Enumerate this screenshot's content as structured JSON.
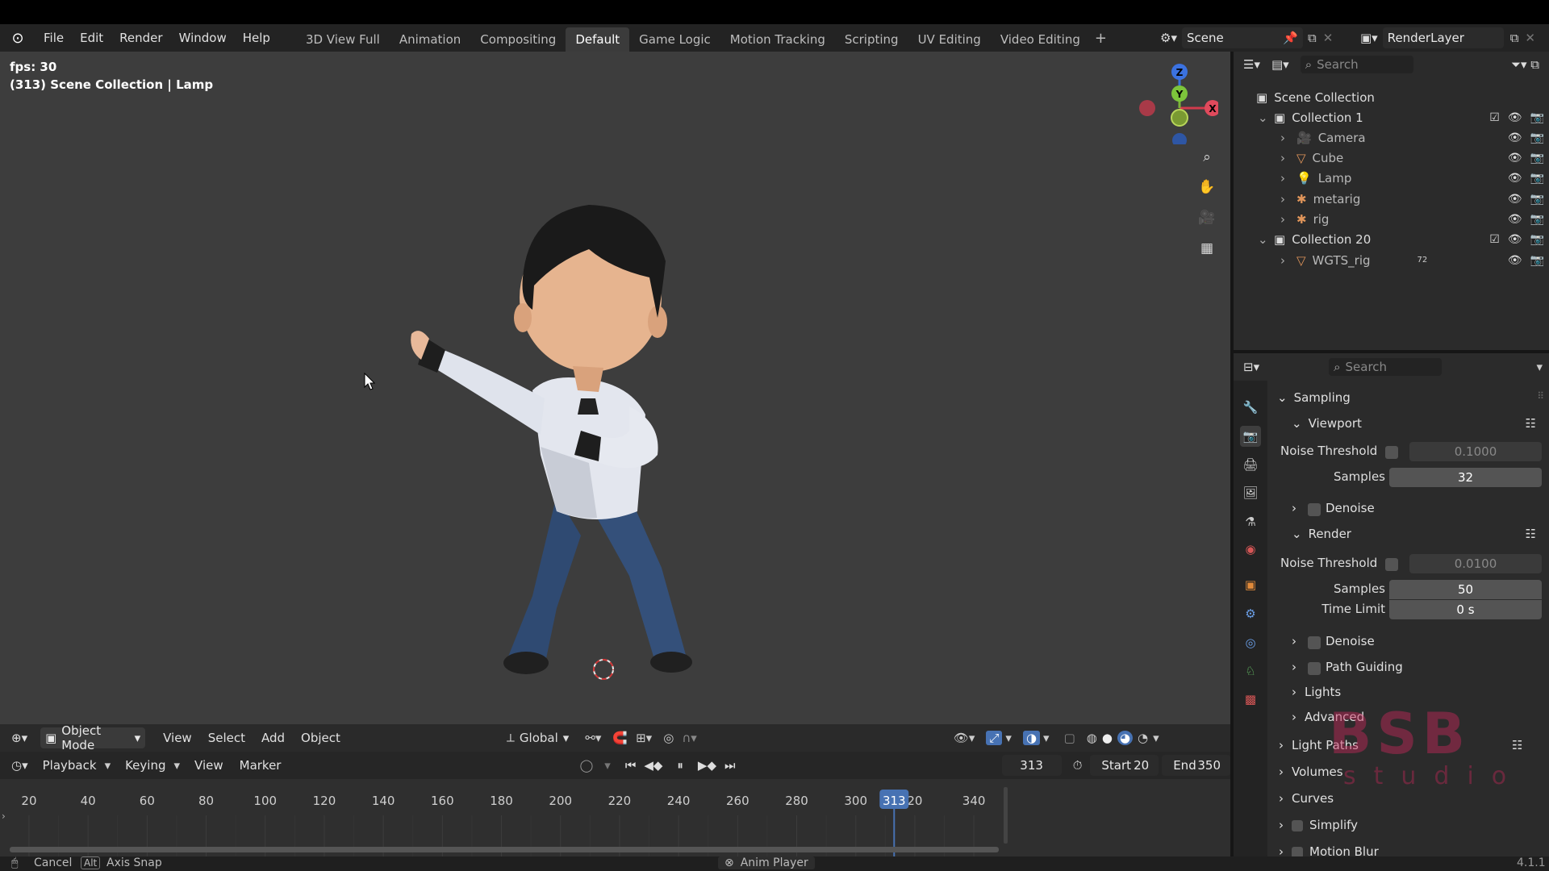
{
  "menu": [
    "File",
    "Edit",
    "Render",
    "Window",
    "Help"
  ],
  "workspaces": [
    "3D View Full",
    "Animation",
    "Compositing",
    "Default",
    "Game Logic",
    "Motion Tracking",
    "Scripting",
    "UV Editing",
    "Video Editing"
  ],
  "active_workspace": "Default",
  "scene_name": "Scene",
  "view_layer": "RenderLayer",
  "viewport": {
    "fps": "fps: 30",
    "context": "(313) Scene Collection | Lamp",
    "gizmo": {
      "z": "Z",
      "y": "Y",
      "x": "X"
    }
  },
  "viewport_header": {
    "mode": "Object Mode",
    "menus": [
      "View",
      "Select",
      "Add",
      "Object"
    ],
    "orientation": "Global"
  },
  "timeline": {
    "menus": [
      "Playback",
      "Keying",
      "View",
      "Marker"
    ],
    "current_frame": "313",
    "start_label": "Start",
    "start": "20",
    "end_label": "End",
    "end": "350",
    "ticks": [
      "20",
      "40",
      "60",
      "80",
      "100",
      "120",
      "140",
      "160",
      "180",
      "200",
      "220",
      "240",
      "260",
      "280",
      "300",
      "320",
      "340"
    ],
    "ticks_shown": [
      "20",
      "40",
      "60",
      "80",
      "100",
      "120",
      "140",
      "160",
      "180",
      "200",
      "220",
      "240",
      "260",
      "280",
      "300",
      "20",
      "340"
    ],
    "frame_min": 14,
    "frame_max": 355
  },
  "status": {
    "cancel": "Cancel",
    "alt": "Alt",
    "axis_snap": "Axis Snap",
    "anim_player": "Anim Player",
    "version": "4.1.1"
  },
  "outliner": {
    "search_placeholder": "Search",
    "root": "Scene Collection",
    "items": [
      {
        "label": "Collection 1",
        "level": 1,
        "type": "collection"
      },
      {
        "label": "Camera",
        "level": 2,
        "type": "camera"
      },
      {
        "label": "Cube",
        "level": 2,
        "type": "mesh"
      },
      {
        "label": "Lamp",
        "level": 2,
        "type": "light"
      },
      {
        "label": "metarig",
        "level": 2,
        "type": "armature"
      },
      {
        "label": "rig",
        "level": 2,
        "type": "armature"
      },
      {
        "label": "Collection 20",
        "level": 1,
        "type": "collection"
      },
      {
        "label": "WGTS_rig",
        "level": 2,
        "type": "mesh"
      }
    ],
    "badge": "72"
  },
  "properties": {
    "search_placeholder": "Search",
    "sampling": "Sampling",
    "viewport": "Viewport",
    "noise_threshold_label": "Noise Threshold",
    "viewport_noise_threshold": "0.1000",
    "samples_label": "Samples",
    "viewport_samples": "32",
    "denoise": "Denoise",
    "render": "Render",
    "render_noise_threshold": "0.0100",
    "render_samples": "50",
    "time_limit_label": "Time Limit",
    "time_limit": "0 s",
    "path_guiding": "Path Guiding",
    "lights": "Lights",
    "advanced": "Advanced",
    "light_paths": "Light Paths",
    "volumes": "Volumes",
    "curves": "Curves",
    "simplify": "Simplify",
    "motion_blur": "Motion Blur"
  },
  "watermark": {
    "line1": "BSB",
    "line2": "studio"
  }
}
